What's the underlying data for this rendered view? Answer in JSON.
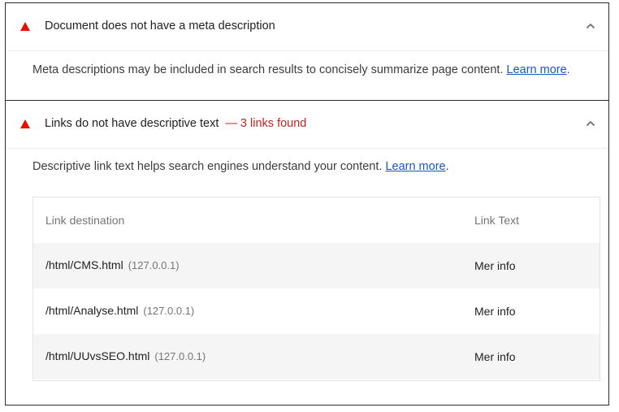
{
  "audits": [
    {
      "title": "Document does not have a meta description",
      "display_value": "",
      "description": "Meta descriptions may be included in search results to concisely summarize page content.",
      "learn_more": "Learn more",
      "trailing": ".",
      "status_color": "#eb0f00"
    },
    {
      "title": "Links do not have descriptive text",
      "display_value": "— 3 links found",
      "description": "Descriptive link text helps search engines understand your content.",
      "learn_more": "Learn more",
      "trailing": ".",
      "status_color": "#eb0f00",
      "table": {
        "headers": [
          "Link destination",
          "Link Text"
        ],
        "rows": [
          {
            "url": "/html/CMS.html",
            "host": "(127.0.0.1)",
            "text": "Mer info"
          },
          {
            "url": "/html/Analyse.html",
            "host": "(127.0.0.1)",
            "text": "Mer info"
          },
          {
            "url": "/html/UUvsSEO.html",
            "host": "(127.0.0.1)",
            "text": "Mer info"
          }
        ]
      }
    }
  ],
  "icons": {
    "fail": "warning-triangle-icon",
    "collapse": "chevron-up-icon"
  }
}
